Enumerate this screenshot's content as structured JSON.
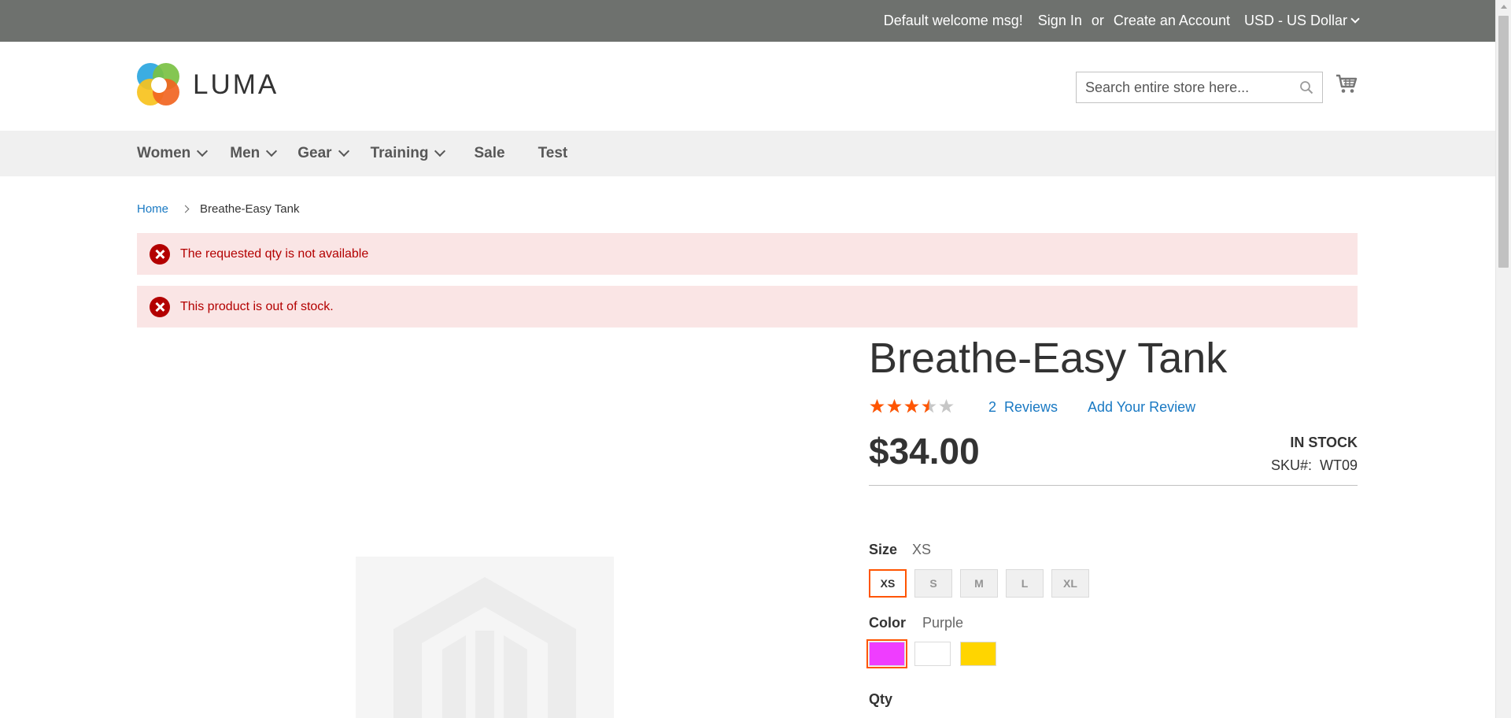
{
  "top_panel": {
    "welcome": "Default welcome msg!",
    "sign_in": "Sign In",
    "or": "or",
    "create_account": "Create an Account",
    "currency": "USD - US Dollar"
  },
  "header": {
    "logo_text": "LUMA",
    "search_placeholder": "Search entire store here...",
    "search_icon": "search-icon",
    "cart_icon": "cart-icon"
  },
  "nav": {
    "items": [
      {
        "label": "Women",
        "has_dropdown": true
      },
      {
        "label": "Men",
        "has_dropdown": true
      },
      {
        "label": "Gear",
        "has_dropdown": true
      },
      {
        "label": "Training",
        "has_dropdown": true
      },
      {
        "label": "Sale",
        "has_dropdown": false
      },
      {
        "label": "Test",
        "has_dropdown": false
      }
    ]
  },
  "breadcrumb": {
    "home": "Home",
    "current": "Breathe-Easy Tank"
  },
  "messages": [
    {
      "text": "The requested qty is not available",
      "type": "error"
    },
    {
      "text": "This product is out of stock.",
      "type": "error"
    }
  ],
  "product": {
    "title": "Breathe-Easy Tank",
    "rating_fraction": 0.7,
    "reviews_count": "2",
    "reviews_label": "Reviews",
    "add_review": "Add Your Review",
    "price": "$34.00",
    "stock_status": "IN STOCK",
    "sku_label": "SKU#:",
    "sku": "WT09",
    "size": {
      "label": "Size",
      "selected": "XS",
      "options": [
        "XS",
        "S",
        "M",
        "L",
        "XL"
      ]
    },
    "color": {
      "label": "Color",
      "selected": "Purple",
      "options": [
        {
          "name": "Purple",
          "hex": "#ef3dff"
        },
        {
          "name": "White",
          "hex": "#ffffff"
        },
        {
          "name": "Yellow",
          "hex": "#ffd500"
        }
      ]
    },
    "qty_label": "Qty"
  },
  "colors": {
    "top_panel_bg": "#6e716e",
    "nav_bg": "#f0f0f0",
    "link": "#1979c3",
    "error_bg": "#fae5e5",
    "error_text": "#b30000",
    "accent": "#ff5501",
    "star_on": "#ff5501",
    "star_off": "#c7c7c7"
  }
}
